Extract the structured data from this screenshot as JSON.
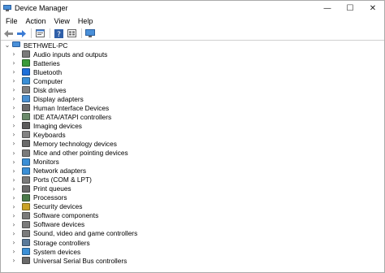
{
  "window": {
    "title": "Device Manager",
    "controls": {
      "minimize": "—",
      "maximize": "☐",
      "close": "✕"
    }
  },
  "menu": [
    "File",
    "Action",
    "View",
    "Help"
  ],
  "toolbar": {
    "buttons": [
      "back-arrow-icon",
      "forward-arrow-icon",
      "properties-icon",
      "help-icon",
      "show-hidden-icon",
      "computer-monitor-icon"
    ]
  },
  "tree": {
    "root": "BETHWEL-PC",
    "items": [
      {
        "label": "Audio inputs and outputs",
        "icon": "speaker-icon",
        "color": "#7a7a7a"
      },
      {
        "label": "Batteries",
        "icon": "battery-icon",
        "color": "#3a9a3a"
      },
      {
        "label": "Bluetooth",
        "icon": "bluetooth-icon",
        "color": "#1e6fd9"
      },
      {
        "label": "Computer",
        "icon": "computer-icon",
        "color": "#3b8fd6"
      },
      {
        "label": "Disk drives",
        "icon": "disk-drive-icon",
        "color": "#808080"
      },
      {
        "label": "Display adapters",
        "icon": "display-adapter-icon",
        "color": "#4a8fd0"
      },
      {
        "label": "Human Interface Devices",
        "icon": "hid-icon",
        "color": "#6a6a6a"
      },
      {
        "label": "IDE ATA/ATAPI controllers",
        "icon": "ide-controller-icon",
        "color": "#6a8a6a"
      },
      {
        "label": "Imaging devices",
        "icon": "camera-icon",
        "color": "#5a5a5a"
      },
      {
        "label": "Keyboards",
        "icon": "keyboard-icon",
        "color": "#808080"
      },
      {
        "label": "Memory technology devices",
        "icon": "memory-icon",
        "color": "#6a6a6a"
      },
      {
        "label": "Mice and other pointing devices",
        "icon": "mouse-icon",
        "color": "#7a7a7a"
      },
      {
        "label": "Monitors",
        "icon": "monitor-icon",
        "color": "#3b8fd6"
      },
      {
        "label": "Network adapters",
        "icon": "network-adapter-icon",
        "color": "#3b8fd6"
      },
      {
        "label": "Ports (COM & LPT)",
        "icon": "port-icon",
        "color": "#7a7a7a"
      },
      {
        "label": "Print queues",
        "icon": "printer-icon",
        "color": "#6a6a6a"
      },
      {
        "label": "Processors",
        "icon": "processor-icon",
        "color": "#4a7a4a"
      },
      {
        "label": "Security devices",
        "icon": "security-key-icon",
        "color": "#c9a227"
      },
      {
        "label": "Software components",
        "icon": "software-component-icon",
        "color": "#7a7a7a"
      },
      {
        "label": "Software devices",
        "icon": "software-device-icon",
        "color": "#7a7a7a"
      },
      {
        "label": "Sound, video and game controllers",
        "icon": "sound-controller-icon",
        "color": "#7a7a7a"
      },
      {
        "label": "Storage controllers",
        "icon": "storage-controller-icon",
        "color": "#5a7a9a"
      },
      {
        "label": "System devices",
        "icon": "system-device-icon",
        "color": "#3b8fd6"
      },
      {
        "label": "Universal Serial Bus controllers",
        "icon": "usb-icon",
        "color": "#6a6a6a"
      }
    ]
  }
}
